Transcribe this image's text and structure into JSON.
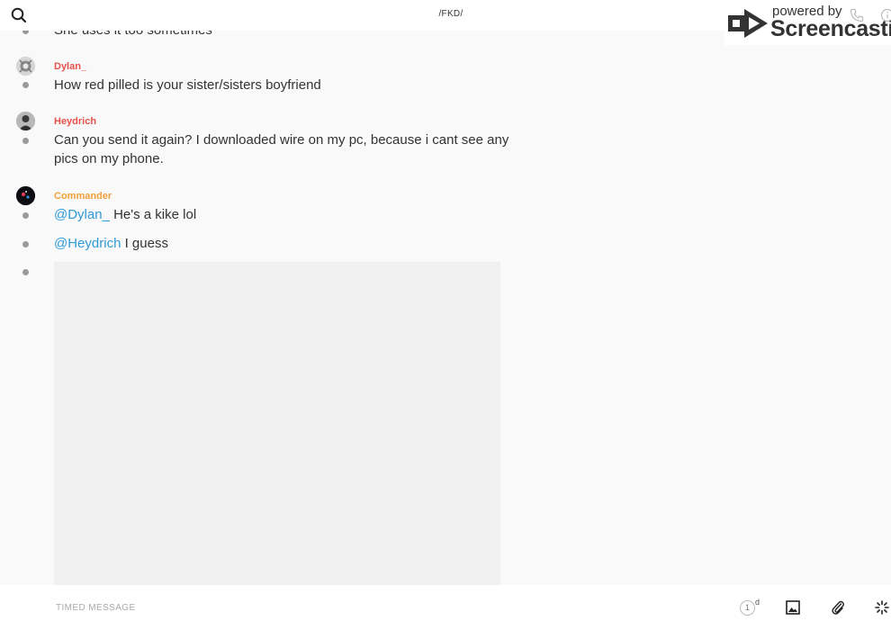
{
  "header": {
    "title": "/FKD/",
    "search_icon": "search-icon",
    "call_icon": "phone-icon",
    "info_icon": "info-icon"
  },
  "watermark": {
    "line1": "powered by",
    "line2": "Screencastify"
  },
  "messages": [
    {
      "sender": "",
      "text": "She uses it too sometimes"
    },
    {
      "sender": "Dylan_",
      "sender_color": "#e8524a",
      "text": "How red pilled is your sister/sisters boyfriend"
    },
    {
      "sender": "Heydrich",
      "sender_color": "#e8524a",
      "lines": [
        "Can you send it again? I downloaded wire on my pc, because i cant see any",
        "pics on my phone."
      ]
    },
    {
      "sender": "Commander",
      "sender_color": "#f0a13a",
      "items": [
        {
          "mention": "@Dylan_",
          "text": " He's a kike lol"
        },
        {
          "mention": "@Heydrich",
          "text": " I guess"
        }
      ]
    }
  ],
  "composer": {
    "placeholder": "TIMED MESSAGE",
    "timer_value": "1",
    "timer_unit": "d",
    "image_icon": "image-icon",
    "attach_icon": "paperclip-icon",
    "ping_icon": "ping-icon"
  },
  "colors": {
    "mention": "#2e9bd6",
    "background": "#f9f9fa"
  }
}
